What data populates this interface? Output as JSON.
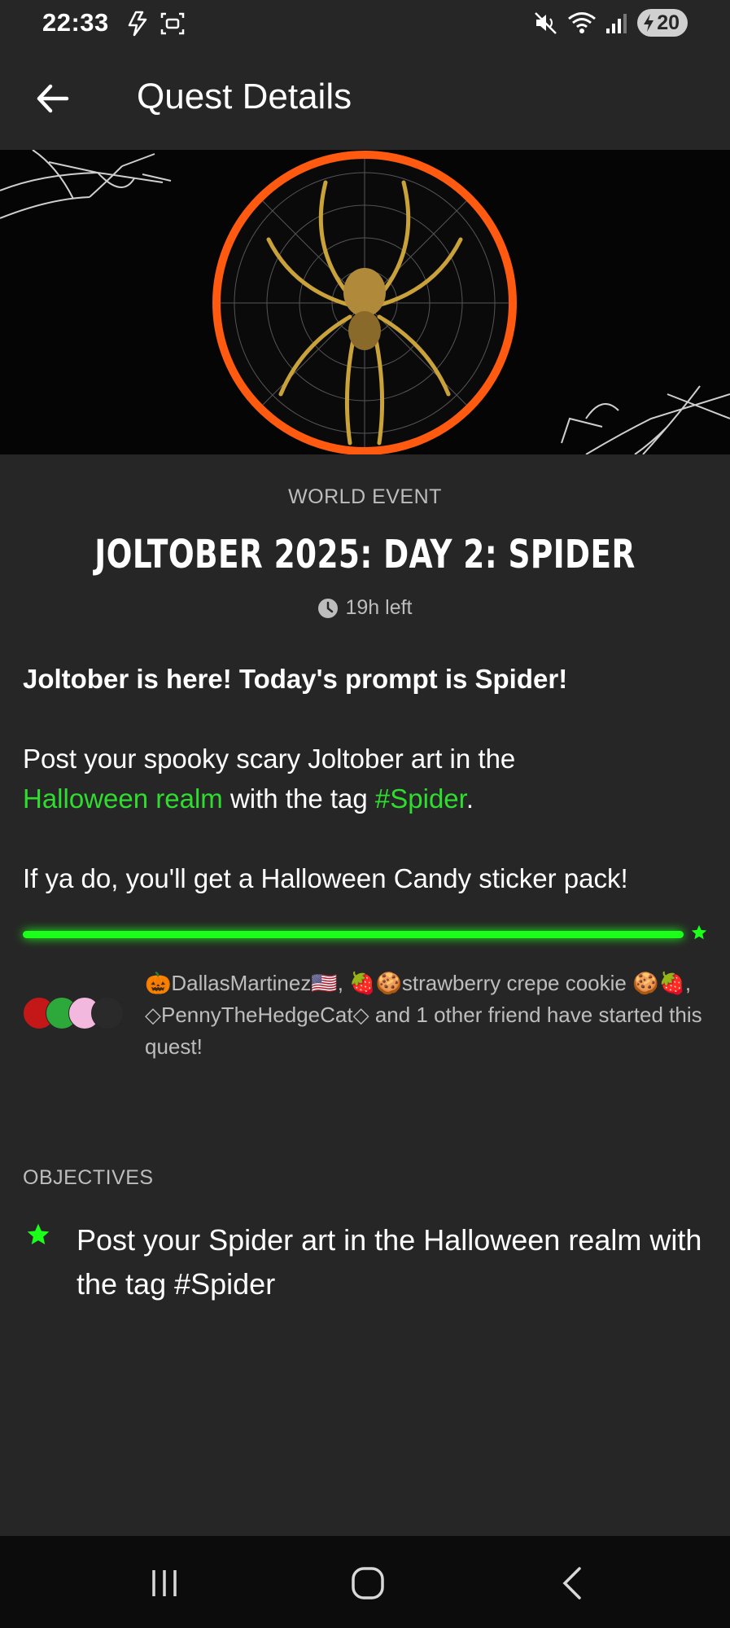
{
  "status_bar": {
    "time": "22:33",
    "battery": "20"
  },
  "app_bar": {
    "title": "Quest Details"
  },
  "quest": {
    "event_type": "WORLD EVENT",
    "title": "JOLTOBER 2025: DAY 2: SPIDER",
    "time_left": "19h left",
    "intro": "Joltober is here! Today's prompt is Spider!",
    "post_line_1": "Post your spooky scary Joltober art in the",
    "realm_link": "Halloween realm",
    "post_line_2": " with the tag ",
    "tag_link": "#Spider",
    "post_line_end": ".",
    "reward_text": "If ya do, you'll get a Halloween Candy sticker pack!",
    "progress": 1.0
  },
  "friends": {
    "text": "🎃DallasMartinez🇺🇸, 🍓🍪strawberry crepe cookie 🍪🍓, ◇PennyTheHedgeCat◇ and 1 other friend have started this quest!"
  },
  "objectives": {
    "label": "OBJECTIVES",
    "items": [
      {
        "text": "Post your Spider art in the Halloween realm with the tag #Spider"
      }
    ]
  },
  "colors": {
    "background": "#262626",
    "accent_green": "#2fdd2f",
    "progress_green": "#1bff1b",
    "hero_ring": "#ff5a10"
  }
}
